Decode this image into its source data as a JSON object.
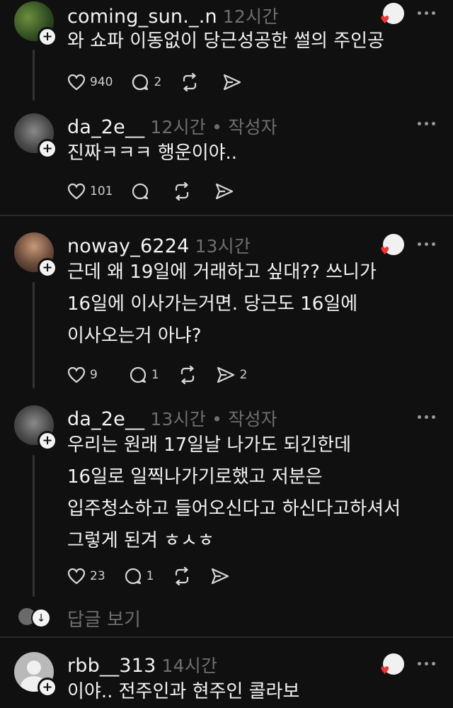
{
  "posts": [
    {
      "username": "coming_sun._.n",
      "time": "12시간",
      "author_tag": "",
      "text": [
        "와 쇼파 이동없이 당근성공한 썰의 주인공"
      ],
      "likes": "940",
      "comments": "2",
      "shares": ""
    },
    {
      "username": "da_2e__",
      "time": "12시간",
      "author_tag": "• 작성자",
      "text": [
        "진짜ㅋㅋㅋ 행운이야.."
      ],
      "likes": "101",
      "comments": "",
      "shares": ""
    },
    {
      "username": "noway_6224",
      "time": "13시간",
      "author_tag": "",
      "text": [
        "근데 왜 19일에 거래하고 싶대?? 쓰니가",
        "16일에 이사가는거면. 당근도 16일에",
        "이사오는거 아냐?"
      ],
      "likes": "9",
      "comments": "1",
      "shares": "2"
    },
    {
      "username": "da_2e__",
      "time": "13시간",
      "author_tag": "• 작성자",
      "text": [
        "우리는 원래 17일날 나가도 되긴한데",
        "16일로 일찍나가기로했고 저분은",
        "입주청소하고 들어오신다고 하신다고하셔서",
        "그렇게 된겨  ㅎㅅㅎ"
      ],
      "likes": "23",
      "comments": "1",
      "shares": ""
    },
    {
      "username": "rbb__313",
      "time": "14시간",
      "author_tag": "",
      "text": [
        "이야.. 전주인과 현주인 콜라보"
      ],
      "likes": "",
      "comments": "",
      "shares": ""
    }
  ],
  "view_replies_label": "답글 보기",
  "colors": {
    "background": "#101010",
    "text": "#f3f3f3",
    "muted": "#6e6e6e",
    "heart": "#e33333"
  }
}
